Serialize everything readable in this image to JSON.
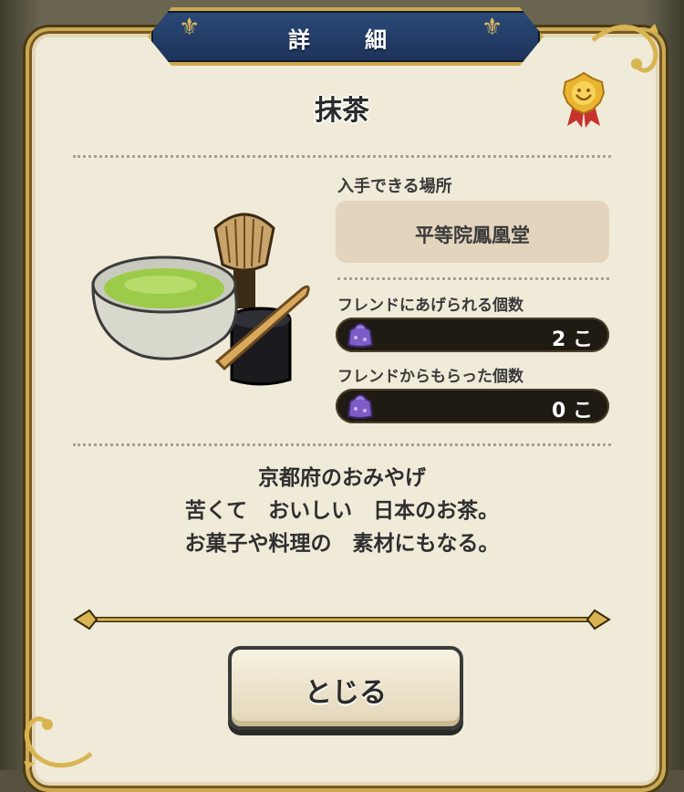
{
  "dialog": {
    "title": "詳　細",
    "item_name": "抹茶",
    "location_label": "入手できる場所",
    "location_value": "平等院鳳凰堂",
    "give_label": "フレンドにあげられる個数",
    "give_count": "2 こ",
    "received_label": "フレンドからもらった個数",
    "received_count": "0 こ",
    "description": [
      "京都府のおみやげ",
      "苦くて　おいしい　日本のお茶。",
      "お菓子や料理の　素材にもなる。"
    ],
    "close_label": "とじる"
  },
  "colors": {
    "panel": "#f0ead8",
    "banner": "#1d3259",
    "gold": "#caa955",
    "count_bar": "#1f1a12"
  },
  "icons": [
    "fleur-de-lis-icon",
    "gold-medal-icon",
    "gift-bag-icon",
    "matcha-bowl-illustration",
    "tea-whisk-illustration"
  ]
}
